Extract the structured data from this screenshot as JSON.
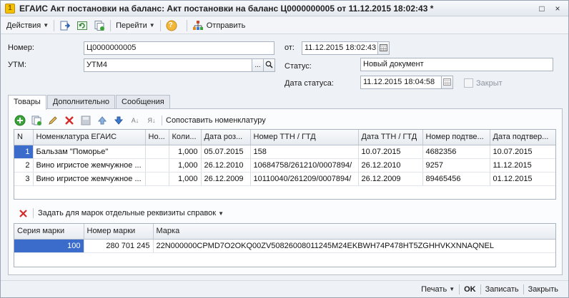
{
  "window": {
    "title": "ЕГАИС Акт постановки на баланс: Акт постановки на баланс Ц0000000005 от 11.12.2015 18:02:43 *",
    "controls": [
      "□",
      "×"
    ]
  },
  "toolbar": {
    "actions_label": "Действия",
    "goto_label": "Перейти",
    "send_label": "Отправить",
    "help_glyph": "?"
  },
  "form": {
    "number_label": "Номер:",
    "number_value": "Ц0000000005",
    "from_label": "от:",
    "from_value": "11.12.2015 18:02:43",
    "utm_label": "УТМ:",
    "utm_value": "УТМ4",
    "utm_select_glyph": "...",
    "status_label": "Статус:",
    "status_value": "Новый документ",
    "status_date_label": "Дата статуса:",
    "status_date_value": "11.12.2015 18:04:58",
    "closed_label": "Закрыт"
  },
  "tabs": [
    {
      "label": "Товары"
    },
    {
      "label": "Дополнительно"
    },
    {
      "label": "Сообщения"
    }
  ],
  "goods": {
    "match_label": "Сопоставить номенклатуру",
    "sort_asc_glyph": "А↓",
    "sort_desc_glyph": "Я↓",
    "columns": [
      "N",
      "Номенклатура ЕГАИС",
      "Но...",
      "Коли...",
      "Дата роз...",
      "Номер ТТН / ГТД",
      "Дата ТТН / ГТД",
      "Номер подтве...",
      "Дата подтвер..."
    ],
    "rows": [
      {
        "n": "1",
        "nom": "Бальзам \"Поморье\"",
        "no": "",
        "qty": "1,000",
        "date_bottle": "05.07.2015",
        "ttn": "158",
        "ttn_date": "10.07.2015",
        "conf_num": "4682356",
        "conf_date": "10.07.2015"
      },
      {
        "n": "2",
        "nom": "Вино игристое жемчужное ...",
        "no": "",
        "qty": "1,000",
        "date_bottle": "26.12.2010",
        "ttn": "10684758/261210/0007894/",
        "ttn_date": "26.12.2010",
        "conf_num": "9257",
        "conf_date": "11.12.2015"
      },
      {
        "n": "3",
        "nom": "Вино игристое жемчужное ...",
        "no": "",
        "qty": "1,000",
        "date_bottle": "26.12.2009",
        "ttn": "10110040/261209/0007894/",
        "ttn_date": "26.12.2009",
        "conf_num": "89465456",
        "conf_date": "01.12.2015"
      }
    ]
  },
  "marks": {
    "set_label": "Задать для марок отдельные реквизиты справок",
    "columns": [
      "Серия марки",
      "Номер марки",
      "Марка"
    ],
    "rows": [
      {
        "series": "100",
        "number": "280 701 245",
        "mark": "22N000000CPMD7O2OKQ00ZV50826008011245M24EKBWH74P478HT5ZGHHVKXNNAQNEL"
      }
    ]
  },
  "bottom": {
    "print_label": "Печать",
    "ok_label": "OK",
    "save_label": "Записать",
    "close_label": "Закрыть"
  },
  "colors": {
    "selection": "#3b6ccc",
    "accent_green": "#3aa33a",
    "delete_red": "#d62a2a"
  }
}
